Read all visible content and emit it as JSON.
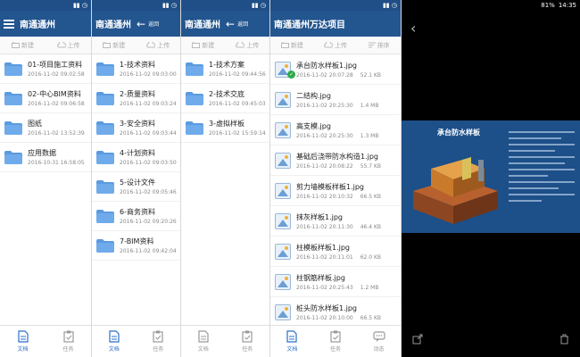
{
  "panel1": {
    "header": {
      "title": "南通通州"
    },
    "toolbar": {
      "new": "新建",
      "upload": "上传"
    },
    "folders": [
      {
        "name": "01-项目施工资料",
        "date": "2016-11-02 09:02:58"
      },
      {
        "name": "02-中心BIM资料",
        "date": "2016-11-02 09:06:58"
      },
      {
        "name": "图纸",
        "date": "2016-11-02 13:52:39"
      },
      {
        "name": "应用数据",
        "date": "2016-10-31 16:58:05"
      }
    ]
  },
  "panel2": {
    "header": {
      "title": "南通通州",
      "back_label": "返回"
    },
    "toolbar": {
      "new": "新建",
      "upload": "上传"
    },
    "folders": [
      {
        "name": "1-技术资料",
        "date": "2016-11-02 09:03:00"
      },
      {
        "name": "2-质量资料",
        "date": "2016-11-02 09:03:24"
      },
      {
        "name": "3-安全资料",
        "date": "2016-11-02 09:03:44"
      },
      {
        "name": "4-计划资料",
        "date": "2016-11-02 09:03:50"
      },
      {
        "name": "5-设计文件",
        "date": "2016-11-02 09:05:46"
      },
      {
        "name": "6-商务资料",
        "date": "2016-11-02 09:20:26"
      },
      {
        "name": "7-BIM资料",
        "date": "2016-11-02 09:42:04"
      }
    ]
  },
  "panel3": {
    "header": {
      "title": "南通通州",
      "back_label": "返回"
    },
    "toolbar": {
      "new": "新建",
      "upload": "上传"
    },
    "folders": [
      {
        "name": "1-技术方案",
        "date": "2016-11-02 09:44:56"
      },
      {
        "name": "2-技术交底",
        "date": "2016-11-02 09:45:03"
      },
      {
        "name": "3-虚拟样板",
        "date": "2016-11-02 15:59:14"
      }
    ]
  },
  "panel4": {
    "header": {
      "title": "南通通州万达项目"
    },
    "toolbar": {
      "new": "新建",
      "upload": "上传",
      "sort": "排序"
    },
    "files": [
      {
        "name": "承台防水样板1.jpg",
        "date": "2016-11-02 20:07:28",
        "size": "52.1 KB"
      },
      {
        "name": "二结构.jpg",
        "date": "2016-11-02 20:25:30",
        "size": "1.4 MB"
      },
      {
        "name": "高支模.jpg",
        "date": "2016-11-02 20:25:30",
        "size": "1.3 MB"
      },
      {
        "name": "基础后浇带防水构造1.jpg",
        "date": "2016-11-02 20:08:22",
        "size": "55.7 KB"
      },
      {
        "name": "剪力墙模板样板1.jpg",
        "date": "2016-11-02 20:10:32",
        "size": "66.5 KB"
      },
      {
        "name": "抹灰样板1.jpg",
        "date": "2016-11-02 20:11:30",
        "size": "46.4 KB"
      },
      {
        "name": "柱模板样板1.jpg",
        "date": "2016-11-02 20:11:01",
        "size": "62.0 KB"
      },
      {
        "name": "柱钢筋样板.jpg",
        "date": "2016-11-02 20:25:43",
        "size": "1.2 MB"
      },
      {
        "name": "桩头防水样板1.jpg",
        "date": "2016-11-02 20:10:00",
        "size": "66.5 KB"
      }
    ]
  },
  "panel5": {
    "status_time": "14:35",
    "status_battery": "81%",
    "preview_title": "承台防水样板"
  },
  "bottom_nav": {
    "docs": "文档",
    "tasks": "任务",
    "dynamic": "动态"
  },
  "colors": {
    "header_blue": "#23558f",
    "folder_blue": "#5b9be0",
    "active_nav": "#2a6fc9",
    "check_green": "#2eaa4a"
  }
}
